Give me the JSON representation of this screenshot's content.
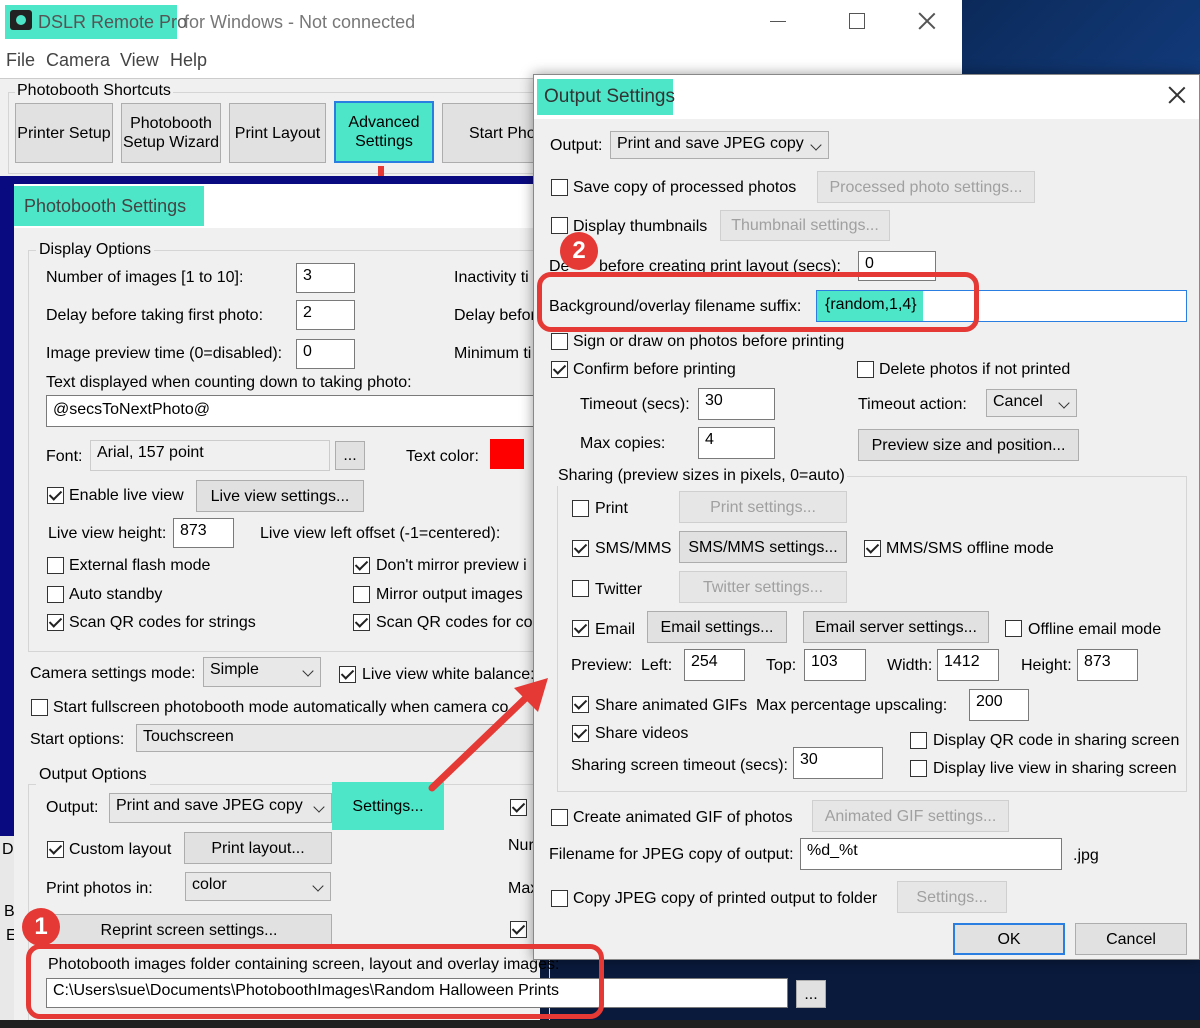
{
  "main_window": {
    "title_app": "DSLR Remote Pro",
    "title_rest": "for Windows - Not connected",
    "menu": [
      "File",
      "Camera",
      "View",
      "Help"
    ],
    "shortcuts_group": "Photobooth Shortcuts",
    "shortcuts": [
      "Printer Setup",
      "Photobooth Setup Wizard",
      "Print Layout",
      "Advanced Settings",
      "Start Pho"
    ],
    "left_edge_letters": [
      "D",
      "B",
      "E"
    ]
  },
  "photobooth_settings": {
    "title": "Photobooth Settings",
    "display_options": "Display Options",
    "num_images_label": "Number of images [1 to 10]:",
    "num_images_value": "3",
    "delay_first_label": "Delay before taking first photo:",
    "delay_first_value": "2",
    "preview_time_label": "Image preview time (0=disabled):",
    "preview_time_value": "0",
    "inactivity_label": "Inactivity ti",
    "delay_before_label": "Delay befor",
    "minimum_label": "Minimum ti",
    "countdown_label": "Text displayed when counting down to taking photo:",
    "countdown_value": "@secsToNextPhoto@",
    "font_label": "Font:",
    "font_value": "Arial, 157 point",
    "font_btn": "...",
    "text_color_label": "Text color:",
    "text_color": "#ff0000",
    "enable_live_view": "Enable live view",
    "live_view_settings_btn": "Live view settings...",
    "live_view_height_label": "Live view height:",
    "live_view_height_value": "873",
    "live_view_left_label": "Live view left offset (-1=centered):",
    "external_flash": "External flash mode",
    "auto_standby": "Auto standby",
    "scan_qr": "Scan QR codes for strings",
    "dont_mirror": "Don't mirror preview i",
    "mirror_output": "Mirror output images",
    "scan_qr_con": "Scan QR codes for con",
    "camera_mode_label": "Camera settings mode:",
    "camera_mode_value": "Simple",
    "live_view_wb": "Live view white balance:",
    "start_fullscreen": "Start fullscreen photobooth mode automatically when camera co",
    "start_options_label": "Start options:",
    "start_options_value": "Touchscreen",
    "output_options": "Output Options",
    "output_label": "Output:",
    "output_value": "Print and save JPEG copy",
    "settings_btn": "Settings...",
    "custom_layout": "Custom layout",
    "print_layout_btn": "Print layout...",
    "print_photos_label": "Print photos in:",
    "print_photos_value": "color",
    "reprint_btn": "Reprint screen settings...",
    "num_label": "Nur",
    "max_label": "Max",
    "folder_label": "Photobooth images folder containing screen, layout and overlay images:",
    "folder_value": "C:\\Users\\sue\\Documents\\PhotoboothImages\\Random Halloween Prints",
    "folder_btn": "..."
  },
  "output_settings": {
    "title": "Output Settings",
    "output_label": "Output:",
    "output_value": "Print and save JPEG copy",
    "save_copy": "Save copy of processed photos",
    "processed_btn": "Processed photo settings...",
    "display_thumbs": "Display thumbnails",
    "thumb_btn": "Thumbnail settings...",
    "delay_print_label_a": "De",
    "delay_print_label_b": "before creating print layout (secs):",
    "delay_print_value": "0",
    "bg_suffix_label": "Background/overlay filename suffix:",
    "bg_suffix_value": "{random,1,4}",
    "sign_draw": "Sign or draw on photos before printing",
    "confirm_print": "Confirm before printing",
    "delete_not_printed": "Delete photos if not printed",
    "timeout_label": "Timeout (secs):",
    "timeout_value": "30",
    "timeout_action_label": "Timeout action:",
    "timeout_action_value": "Cancel",
    "max_copies_label": "Max copies:",
    "max_copies_value": "4",
    "preview_size_btn": "Preview size and position...",
    "sharing_group": "Sharing (preview sizes in pixels, 0=auto)",
    "print": "Print",
    "print_settings_btn": "Print settings...",
    "sms": "SMS/MMS",
    "sms_settings_btn": "SMS/MMS settings...",
    "sms_offline": "MMS/SMS offline mode",
    "twitter": "Twitter",
    "twitter_settings_btn": "Twitter settings...",
    "email": "Email",
    "email_settings_btn": "Email settings...",
    "email_server_btn": "Email server settings...",
    "offline_email": "Offline email mode",
    "preview_label": "Preview:",
    "left_label": "Left:",
    "left_value": "254",
    "top_label": "Top:",
    "top_value": "103",
    "width_label": "Width:",
    "width_value": "1412",
    "height_label": "Height:",
    "height_value": "873",
    "share_gifs": "Share animated GIFs",
    "max_upscale_label": "Max percentage upscaling:",
    "max_upscale_value": "200",
    "share_videos": "Share videos",
    "display_qr": "Display QR code in sharing screen",
    "display_live": "Display live view in sharing screen",
    "sharing_timeout_label": "Sharing screen timeout (secs):",
    "sharing_timeout_value": "30",
    "create_gif": "Create animated GIF of photos",
    "gif_settings_btn": "Animated GIF settings...",
    "filename_label": "Filename for JPEG copy of output:",
    "filename_value": "%d_%t",
    "filename_ext": ".jpg",
    "copy_jpeg": "Copy JPEG copy of printed output to folder",
    "copy_settings_btn": "Settings...",
    "ok_btn": "OK",
    "cancel_btn": "Cancel"
  },
  "annotations": {
    "badge1": "1",
    "badge2": "2",
    "accent": "#e53935",
    "highlight": "#4de6c8"
  }
}
